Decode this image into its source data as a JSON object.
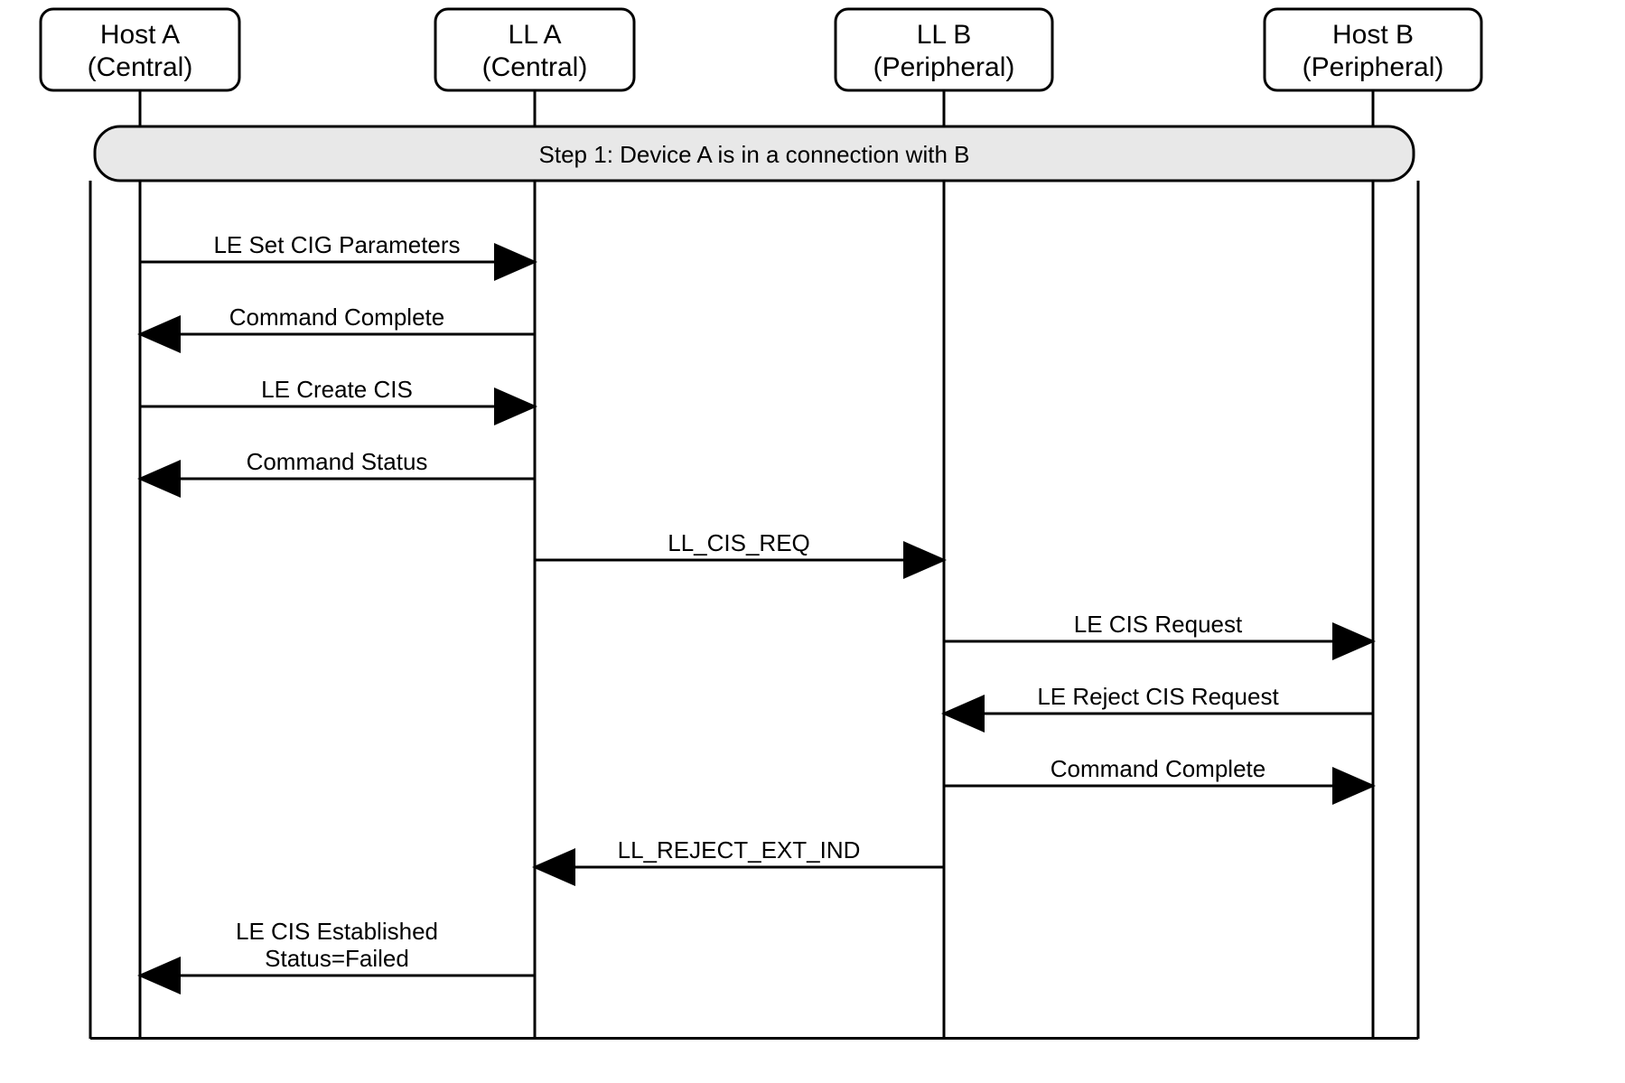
{
  "lifelines": [
    {
      "id": "hostA",
      "line1": "Host A",
      "line2": "(Central)"
    },
    {
      "id": "llA",
      "line1": "LL A",
      "line2": "(Central)"
    },
    {
      "id": "llB",
      "line1": "LL B",
      "line2": "(Peripheral)"
    },
    {
      "id": "hostB",
      "line1": "Host B",
      "line2": "(Peripheral)"
    }
  ],
  "step": {
    "label": "Step 1:  Device A is in a connection with B"
  },
  "messages": [
    {
      "id": "m1",
      "label": "LE Set CIG Parameters"
    },
    {
      "id": "m2",
      "label": "Command Complete"
    },
    {
      "id": "m3",
      "label": "LE Create CIS"
    },
    {
      "id": "m4",
      "label": "Command Status"
    },
    {
      "id": "m5",
      "label": "LL_CIS_REQ"
    },
    {
      "id": "m6",
      "label": "LE CIS Request"
    },
    {
      "id": "m7",
      "label": "LE Reject CIS Request"
    },
    {
      "id": "m8",
      "label": "Command Complete"
    },
    {
      "id": "m9",
      "label": "LL_REJECT_EXT_IND"
    },
    {
      "id": "m10",
      "label": "LE CIS Established"
    },
    {
      "id": "m10b",
      "label": "Status=Failed"
    }
  ]
}
